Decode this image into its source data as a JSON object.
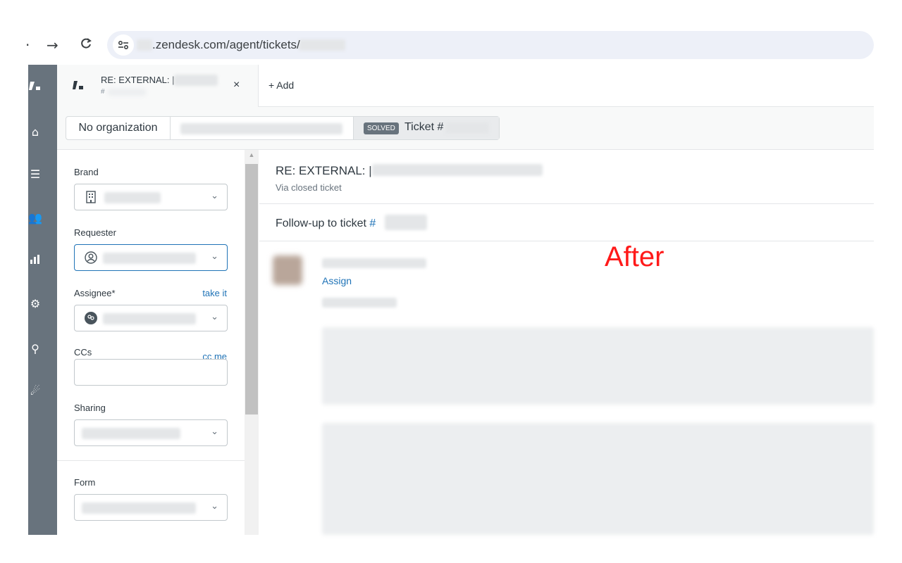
{
  "browser": {
    "back_icon": "←",
    "forward_icon": "→",
    "reload_icon": "C",
    "site_info_icon": "tune-icon",
    "url": ".zendesk.com/agent/tickets/"
  },
  "tabs": {
    "ticket_title": "RE: EXTERNAL: |",
    "ticket_subtitle": "#",
    "close_label": "×",
    "add_label": "+ Add"
  },
  "context": {
    "organization": "No organization",
    "status_badge": "SOLVED",
    "ticket_label": "Ticket #"
  },
  "properties": {
    "brand_label": "Brand",
    "requester_label": "Requester",
    "assignee_label": "Assignee*",
    "take_it_label": "take it",
    "ccs_label": "CCs",
    "cc_me_label": "cc me",
    "sharing_label": "Sharing",
    "form_label": "Form"
  },
  "conversation": {
    "title": "RE: EXTERNAL: |",
    "via": "Via closed ticket",
    "followup_text": "Follow-up to ticket ",
    "followup_link": "#",
    "assign_label": "Assign"
  },
  "annotation": {
    "text": "After",
    "color": "#ff1a1a"
  },
  "colors": {
    "rail": "#68737d",
    "link": "#1f73b7",
    "badge": "#68737d"
  }
}
